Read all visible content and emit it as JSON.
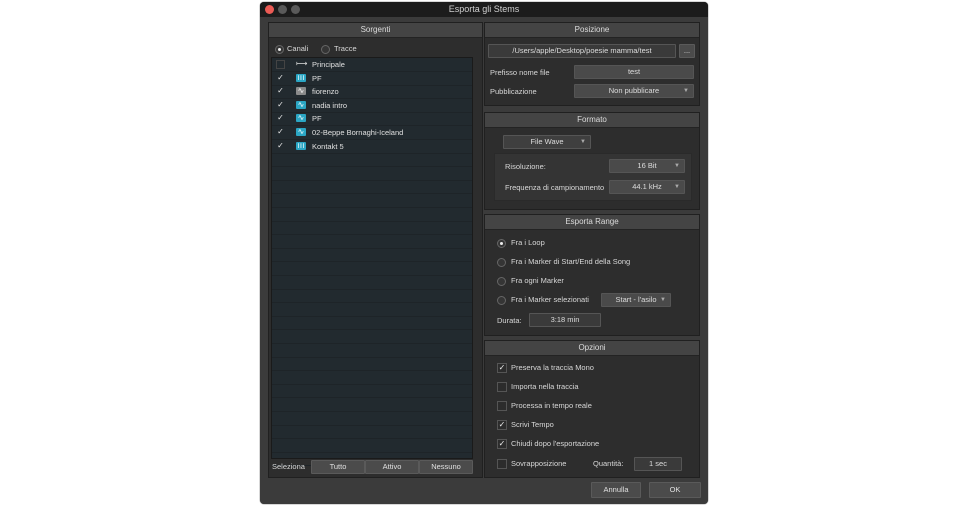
{
  "window": {
    "title": "Esporta gli Stems"
  },
  "sources": {
    "header": "Sorgenti",
    "mode_channels": "Canali",
    "mode_tracks": "Tracce",
    "items": [
      {
        "label": "Principale",
        "checked": false,
        "icon": "main-output-icon"
      },
      {
        "label": "PF",
        "checked": true,
        "icon": "piano-icon"
      },
      {
        "label": "fiorenzo",
        "checked": true,
        "icon": "audio-wave-icon"
      },
      {
        "label": "nadia intro",
        "checked": true,
        "icon": "audio-wave-icon"
      },
      {
        "label": "PF",
        "checked": true,
        "icon": "audio-wave-icon"
      },
      {
        "label": "02-Beppe Bornaghi-Iceland",
        "checked": true,
        "icon": "audio-wave-icon"
      },
      {
        "label": "Kontakt 5",
        "checked": true,
        "icon": "piano-icon"
      }
    ],
    "select_label": "Seleziona",
    "select_all": "Tutto",
    "select_active": "Attivo",
    "select_none": "Nessuno"
  },
  "position": {
    "header": "Posizione",
    "path": "/Users/apple/Desktop/poesie mamma/test",
    "browse": "...",
    "prefix_label": "Prefisso nome file",
    "prefix_value": "test",
    "publish_label": "Pubblicazione",
    "publish_value": "Non pubblicare"
  },
  "format": {
    "header": "Formato",
    "type": "File Wave",
    "resolution_label": "Risoluzione:",
    "resolution_value": "16 Bit",
    "samplerate_label": "Frequenza di campionamento",
    "samplerate_value": "44.1 kHz"
  },
  "range": {
    "header": "Esporta Range",
    "opt1": "Fra i Loop",
    "opt2": "Fra i Marker di Start/End della Song",
    "opt3": "Fra ogni Marker",
    "opt4": "Fra i Marker selezionati",
    "marker_select": "Start - l'asilo",
    "duration_label": "Durata:",
    "duration_value": "3:18 min"
  },
  "options": {
    "header": "Opzioni",
    "mono": "Preserva la traccia Mono",
    "import": "Importa nella traccia",
    "realtime": "Processa in tempo reale",
    "tempo": "Scrivi Tempo",
    "close_after": "Chiudi dopo l'esportazione",
    "overlap": "Sovrapposizione",
    "quantity_label": "Quantità:",
    "quantity_value": "1 sec"
  },
  "footer": {
    "cancel": "Annulla",
    "ok": "OK"
  },
  "colors": {
    "close": "#ec5b55",
    "inactive_dot": "#5a5a5a",
    "icon_teal": "#2ba6c4",
    "icon_gray": "#8a8a8a"
  }
}
